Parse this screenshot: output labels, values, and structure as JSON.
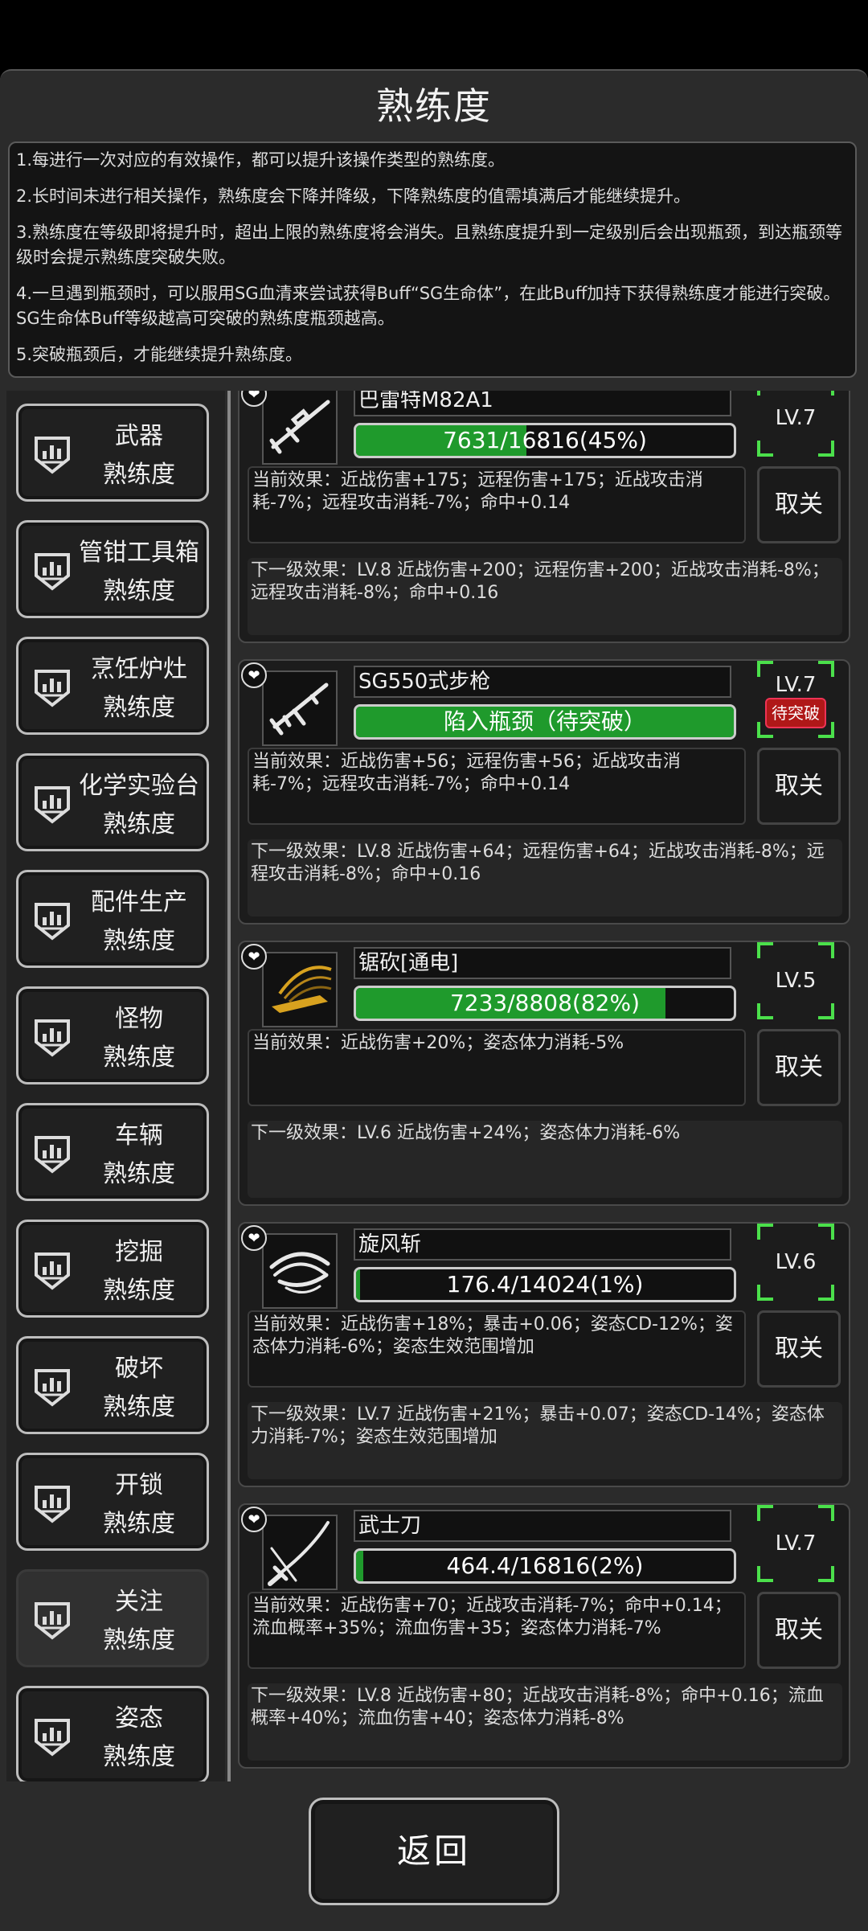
{
  "title": "熟练度",
  "description": [
    "1.每进行一次对应的有效操作，都可以提升该操作类型的熟练度。",
    "2.长时间未进行相关操作，熟练度会下降并降级，下降熟练度的值需填满后才能继续提升。",
    "3.熟练度在等级即将提升时，超出上限的熟练度将会消失。且熟练度提升到一定级别后会出现瓶颈，到达瓶颈等级时会提示熟练度突破失败。",
    "4.一旦遇到瓶颈时，可以服用SG血清来尝试获得Buff“SG生命体”，在此Buff加持下获得熟练度才能进行突破。SG生命体Buff等级越高可突破的熟练度瓶颈越高。",
    "5.突破瓶颈后，才能继续提升熟练度。"
  ],
  "categories": [
    {
      "line1": "武器",
      "line2": "熟练度",
      "active": false
    },
    {
      "line1": "管钳工具箱",
      "line2": "熟练度",
      "active": false
    },
    {
      "line1": "烹饪炉灶",
      "line2": "熟练度",
      "active": false
    },
    {
      "line1": "化学实验台",
      "line2": "熟练度",
      "active": false
    },
    {
      "line1": "配件生产",
      "line2": "熟练度",
      "active": false
    },
    {
      "line1": "怪物",
      "line2": "熟练度",
      "active": false
    },
    {
      "line1": "车辆",
      "line2": "熟练度",
      "active": false
    },
    {
      "line1": "挖掘",
      "line2": "熟练度",
      "active": false
    },
    {
      "line1": "破坏",
      "line2": "熟练度",
      "active": false
    },
    {
      "line1": "开锁",
      "line2": "熟练度",
      "active": false
    },
    {
      "line1": "关注",
      "line2": "熟练度",
      "active": true
    },
    {
      "line1": "姿态",
      "line2": "熟练度",
      "active": false
    }
  ],
  "items": [
    {
      "name": "巴雷特M82A1",
      "icon": "sniper-rifle-icon",
      "progress_text": "7631/16816(45%)",
      "progress": 0.45,
      "level": "LV.7",
      "bottleneck": "",
      "current": "当前效果：近战伤害+175；远程伤害+175；近战攻击消耗-7%；远程攻击消耗-7%；命中+0.14",
      "next": "下一级效果：LV.8 近战伤害+200；远程伤害+200；近战攻击消耗-8%；远程攻击消耗-8%；命中+0.16",
      "cancel": "取关"
    },
    {
      "name": "SG550式步枪",
      "icon": "assault-rifle-icon",
      "progress_text": "陷入瓶颈（待突破）",
      "progress": 1.0,
      "level": "LV.7",
      "bottleneck": "待突破",
      "current": "当前效果：近战伤害+56；远程伤害+56；近战攻击消耗-7%；远程攻击消耗-7%；命中+0.14",
      "next": "下一级效果：LV.8 近战伤害+64；远程伤害+64；近战攻击消耗-8%；远程攻击消耗-8%；命中+0.16",
      "cancel": "取关"
    },
    {
      "name": "锯砍[通电]",
      "icon": "chainsaw-slash-icon",
      "progress_text": "7233/8808(82%)",
      "progress": 0.82,
      "level": "LV.5",
      "bottleneck": "",
      "current": "当前效果：近战伤害+20%；姿态体力消耗-5%",
      "next": "下一级效果：LV.6 近战伤害+24%；姿态体力消耗-6%",
      "cancel": "取关"
    },
    {
      "name": "旋风斩",
      "icon": "whirlwind-slash-icon",
      "progress_text": "176.4/14024(1%)",
      "progress": 0.01,
      "level": "LV.6",
      "bottleneck": "",
      "current": "当前效果：近战伤害+18%；暴击+0.06；姿态CD-12%；姿态体力消耗-6%；姿态生效范围增加",
      "next": "下一级效果：LV.7 近战伤害+21%；暴击+0.07；姿态CD-14%；姿态体力消耗-7%；姿态生效范围增加",
      "cancel": "取关"
    },
    {
      "name": "武士刀",
      "icon": "katana-icon",
      "progress_text": "464.4/16816(2%)",
      "progress": 0.02,
      "level": "LV.7",
      "bottleneck": "",
      "current": "当前效果：近战伤害+70；近战攻击消耗-7%；命中+0.14；流血概率+35%；流血伤害+35；姿态体力消耗-7%",
      "next": "下一级效果：LV.8 近战伤害+80；近战攻击消耗-8%；命中+0.16；流血概率+40%；流血伤害+40；姿态体力消耗-8%",
      "cancel": "取关"
    }
  ],
  "back_label": "返回",
  "colors": {
    "progress_fill": "#1f9a2c",
    "level_corner": "#4be04b",
    "bottleneck_badge": "#b01818"
  }
}
